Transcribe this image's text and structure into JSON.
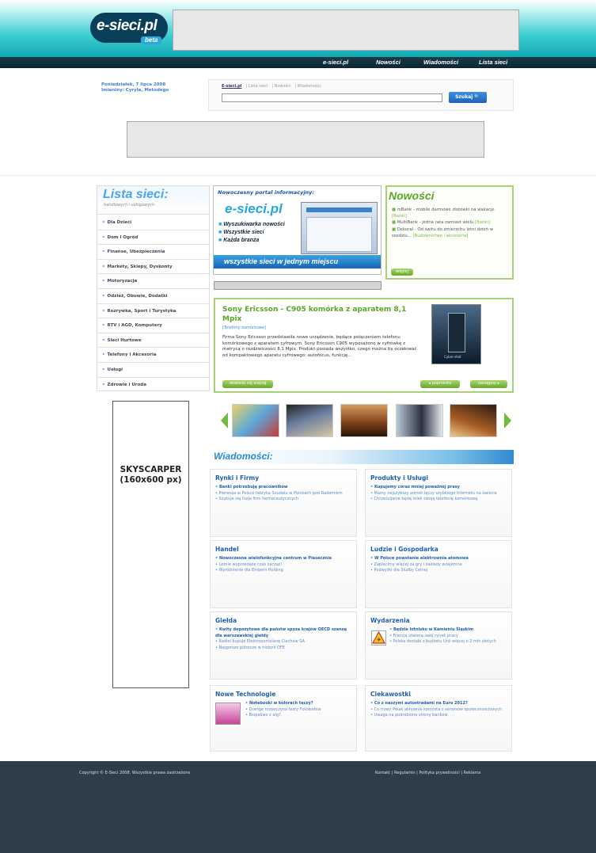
{
  "header": {
    "logo_text": "e-sieci.pl",
    "logo_badge": "beta",
    "nav": [
      "e-sieci.pl",
      "Nowości",
      "Wiadomości",
      "Lista sieci"
    ]
  },
  "date_info": {
    "line1": "Poniedziałek, 7 lipca 2008",
    "line2": "Imieniny: Cyryla, Metodego"
  },
  "search": {
    "tabs": [
      "E-sieci.pl",
      "Lista sieci",
      "Nowości",
      "Wiadomości"
    ],
    "button_label": "Szukaj",
    "placeholder": ""
  },
  "lista_sieci": {
    "title": "Lista sieci:",
    "subtitle": "handlowych i usługowych",
    "items": [
      "Dla Dzieci",
      "Dom i Ogród",
      "Finanse, Ubezpieczenia",
      "Markety, Sklepy, Dyskonty",
      "Motoryzacja",
      "Odzież, Obuwie, Dodatki",
      "Rozrywka, Sport i Turystyka",
      "RTV i AGD, Komputery",
      "Sieci Hurtowe",
      "Telefony i Akcesoria",
      "Usługi",
      "Zdrowie i Uroda"
    ]
  },
  "skyscraper": {
    "line1": "SKYSCARPER",
    "line2": "(160x600 px)"
  },
  "promo": {
    "heading": "Nowoczesny portal informacyjny:",
    "brand": "e-sieci.pl",
    "points": [
      "Wyszukiwarka nowości",
      "Wszystkie sieci",
      "Każda branża"
    ],
    "bar_text": "wszystkie sieci w jednym miejscu"
  },
  "nowosci": {
    "title": "Nowości",
    "items": [
      {
        "text": "mBank - mobile darmowe złotówki na wakacje",
        "tag": "[Banki]"
      },
      {
        "text": "MultiBank - jedna rata zamiast wielu",
        "tag": "[Banki]"
      },
      {
        "text": "Dekoral - Od świtu do zmierzchu letni dzień w ssedziu...",
        "tag": "[Budownictwo i akcesoria]"
      }
    ],
    "more_label": "więcej"
  },
  "article": {
    "title": "Sony Ericsson - C905 komórka z aparatem 8,1 Mpix",
    "category": "[Telefony komórkowe]",
    "body": "Firma Sony Ericsson przedstawiła nowe urządzenie, będące połączeniem telefonu komórkowego z aparatem cyfrowym. Sony Ericsson C905 wyposażono w cyfrówkę z matrycą o rozdzielczości 8,1 Mpix. Produkt posiada wszystko, czego można by oczekiwać od kompaktowego aparatu cyfrowego: autofocus, funkcję...",
    "image_caption": "Cyber-shot",
    "read_more": "dowiedz się więcej",
    "prev": "poprzedni",
    "next": "następny"
  },
  "wiadomosci": {
    "title": "Wiadomości:",
    "sections": [
      {
        "title": "Rynki i Firmy",
        "items": [
          "Banki potrzebują pracowników",
          "Pierwsza w Polsce fabryka Soudalu w Pionkach pod Radomiem",
          "Szykuje się fuzja firm farmaceutycznych"
        ]
      },
      {
        "title": "Produkty i Usługi",
        "items": [
          "Kupujemy coraz mniej poważnej prasy",
          "Mamy najszybszy wzrost łączy szybkiego Internetu na świecie",
          "Chrześcijanie będą mieli swoją telefonię komórkową"
        ]
      },
      {
        "title": "Handel",
        "items": [
          "Nowoczesne wielofunkcyjne centrum w Piasecznie",
          "Letnie wyprzedaże czas zacząć!",
          "Wyróżnienie dla Emperii Holding"
        ]
      },
      {
        "title": "Ludzie i Gospodarka",
        "items": [
          "W Polsce powstanie elektrownia atomowa",
          "Zapłacimy więcej za gry i zakłady wzajemne",
          "Podwyżki dla Służby Celnej"
        ]
      },
      {
        "title": "Giełda",
        "items": [
          "Kwity depozytowe dla państw spoza krajów OECD szansą dla warszawskiej giełdy",
          "Radiol kupuje Elektroporcelanę Ciechów SA",
          "Najgorsze półrocze w historii OFE"
        ]
      },
      {
        "title": "Wydarzenia",
        "items": [
          "Będzie lotnisko w Kamieniu Śląskim",
          "Francja otwiera swój rynek pracy",
          "Polska dostała z budżetu Unii więcej o 2 mln złotych"
        ]
      },
      {
        "title": "Nowe Technologie",
        "items": [
          "Notebooki w kolorach tęczy?",
          "Orange rozpoczyna testy Fotokodów",
          "Biopaliwo z alg?"
        ]
      },
      {
        "title": "Ciekawostki",
        "items": [
          "Co z naszymi autostradami na Euro 2012?",
          "Co trzeci Polak aktywnie korzysta z serwisów społecznościowych",
          "Uwaga na podrobione strony banków"
        ]
      }
    ]
  },
  "footer": {
    "copyright": "Copyright © E-Sieci 2008. Wszystkie prawa zastrzeżone",
    "links": [
      "Kontakt",
      "Regulamin",
      "Polityka prywatności",
      "Reklama"
    ]
  }
}
